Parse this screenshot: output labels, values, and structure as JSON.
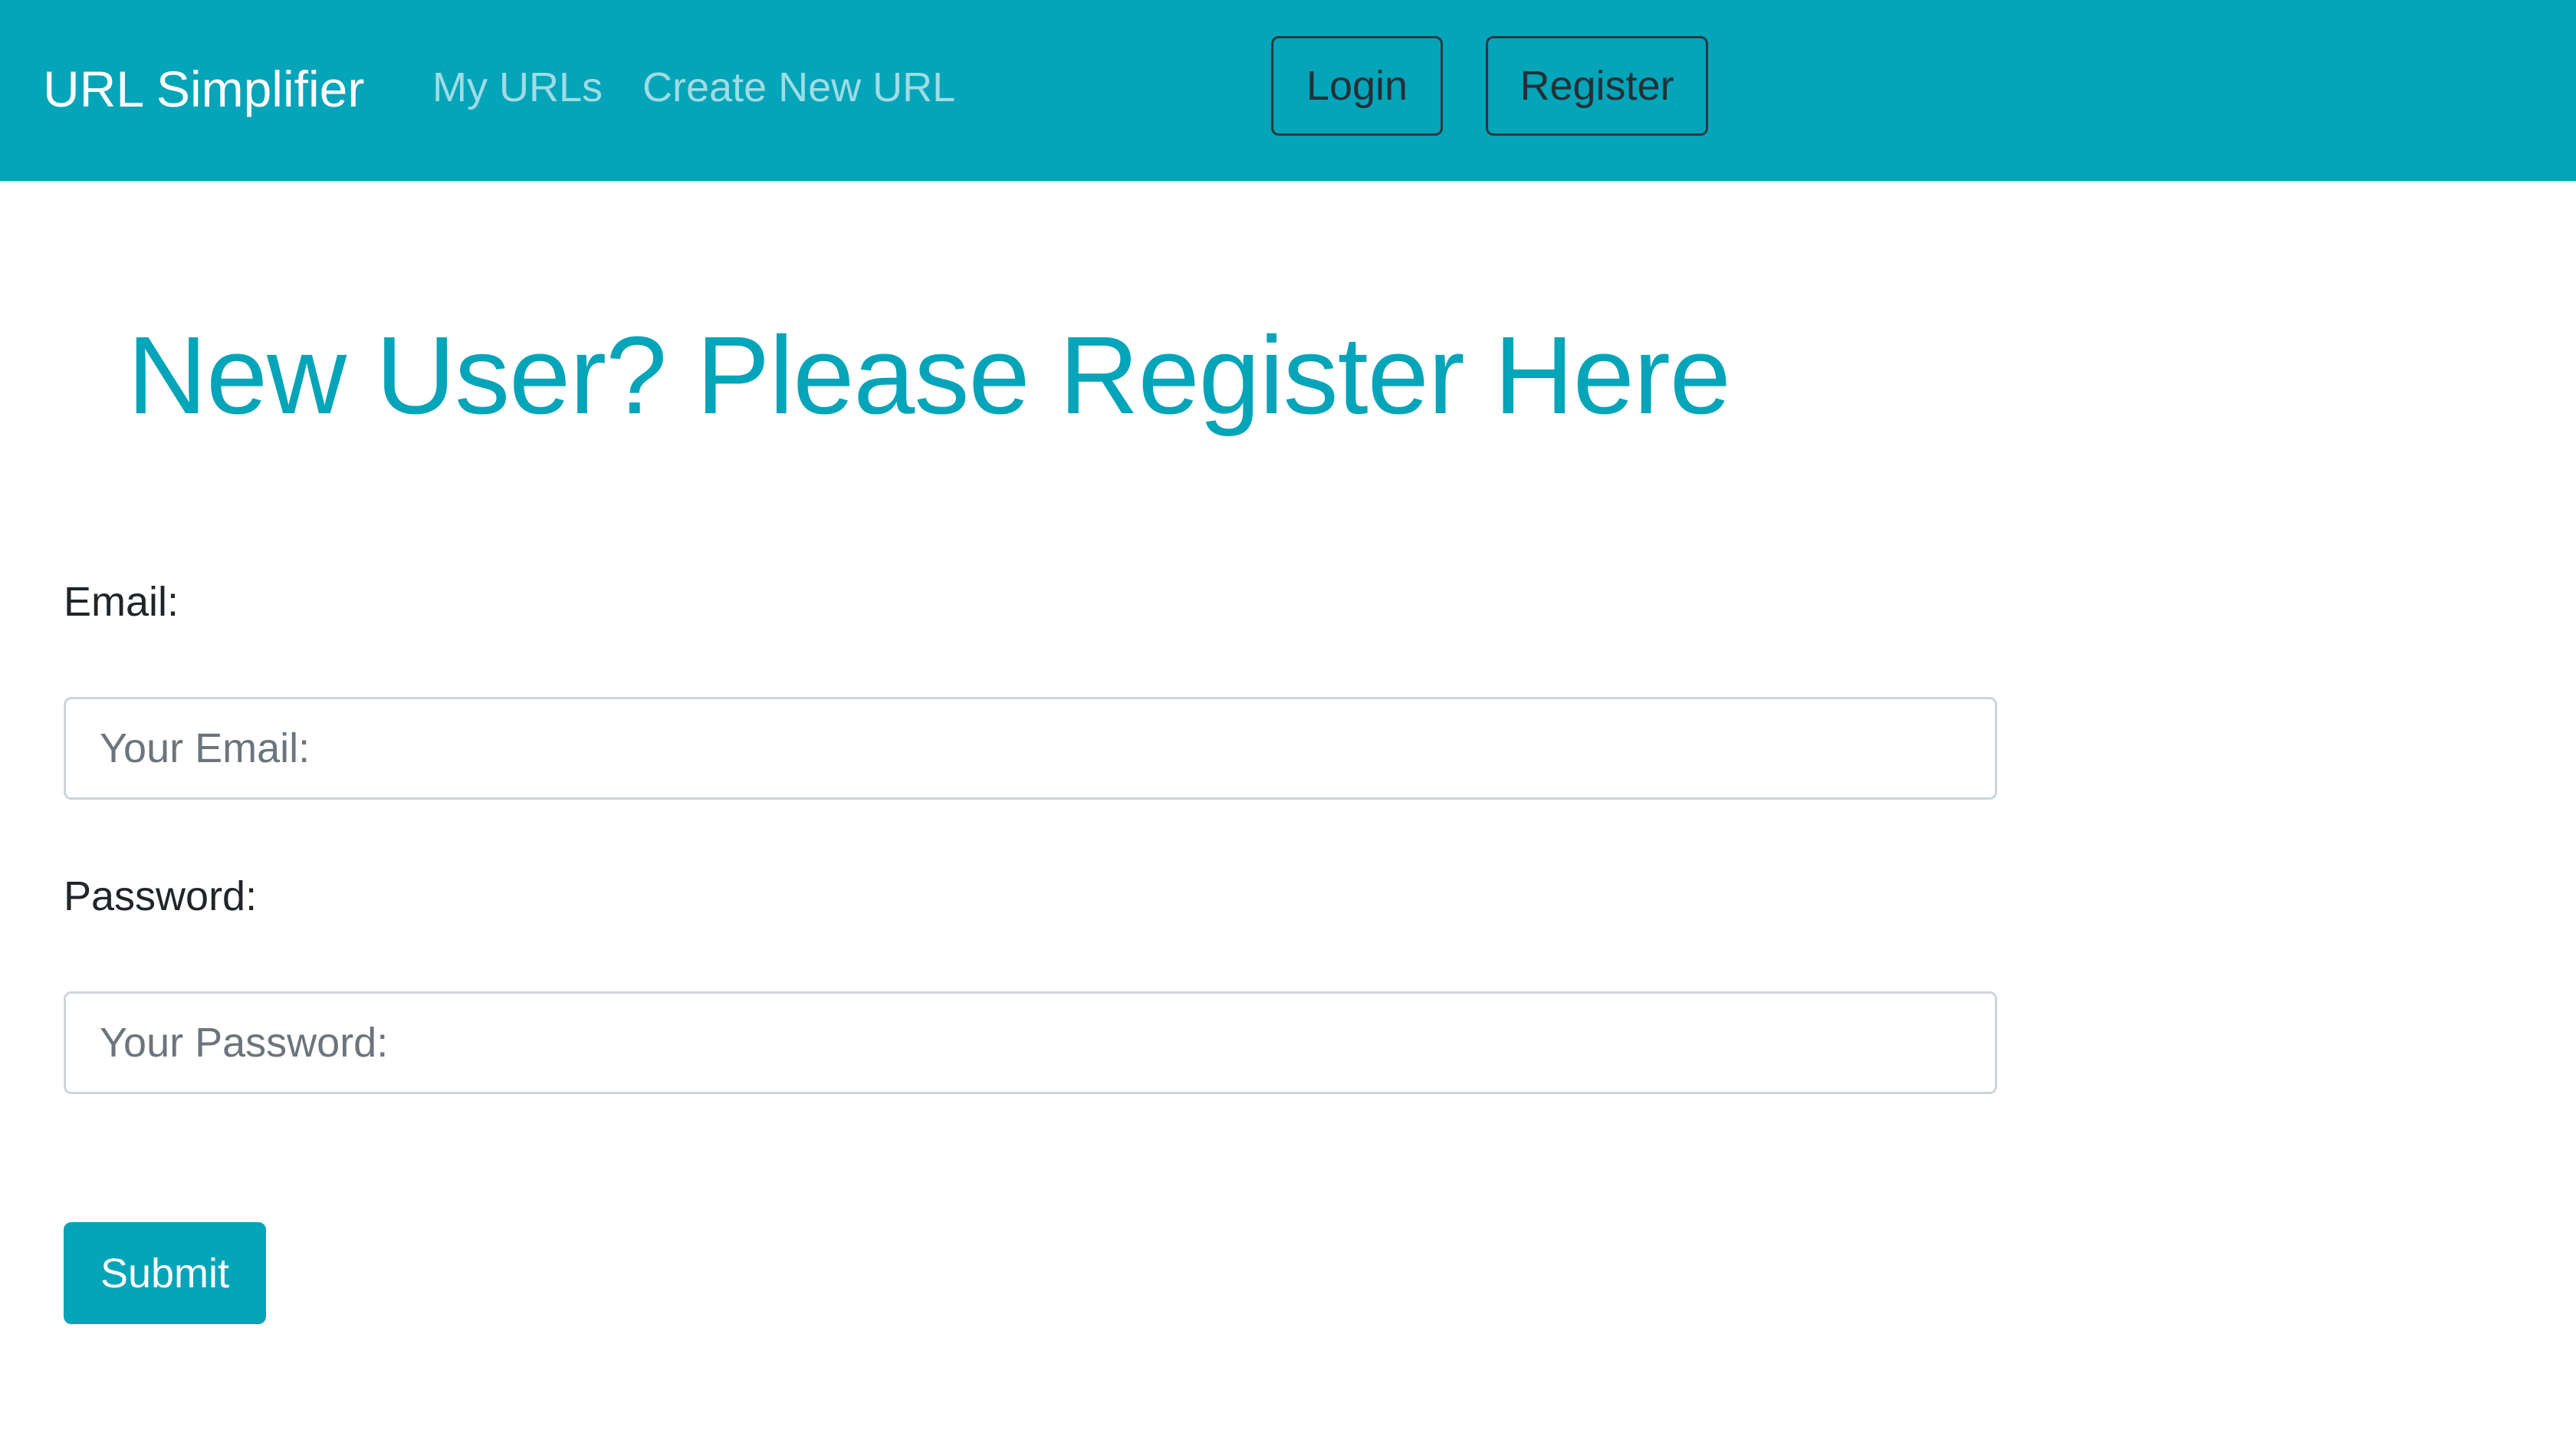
{
  "navbar": {
    "brand": "URL Simplifier",
    "links": [
      {
        "label": "My URLs"
      },
      {
        "label": "Create New URL"
      }
    ],
    "login_label": "Login",
    "register_label": "Register",
    "background_color": "#04a4b9"
  },
  "main": {
    "heading": "New User? Please Register Here",
    "form": {
      "email_label": "Email:",
      "email_value": "",
      "email_placeholder": "Your Email:",
      "password_label": "Password:",
      "password_value": "",
      "password_placeholder": "Your Password:",
      "submit_label": "Submit"
    }
  },
  "colors": {
    "accent": "#04a4b9",
    "text": "#212529"
  }
}
